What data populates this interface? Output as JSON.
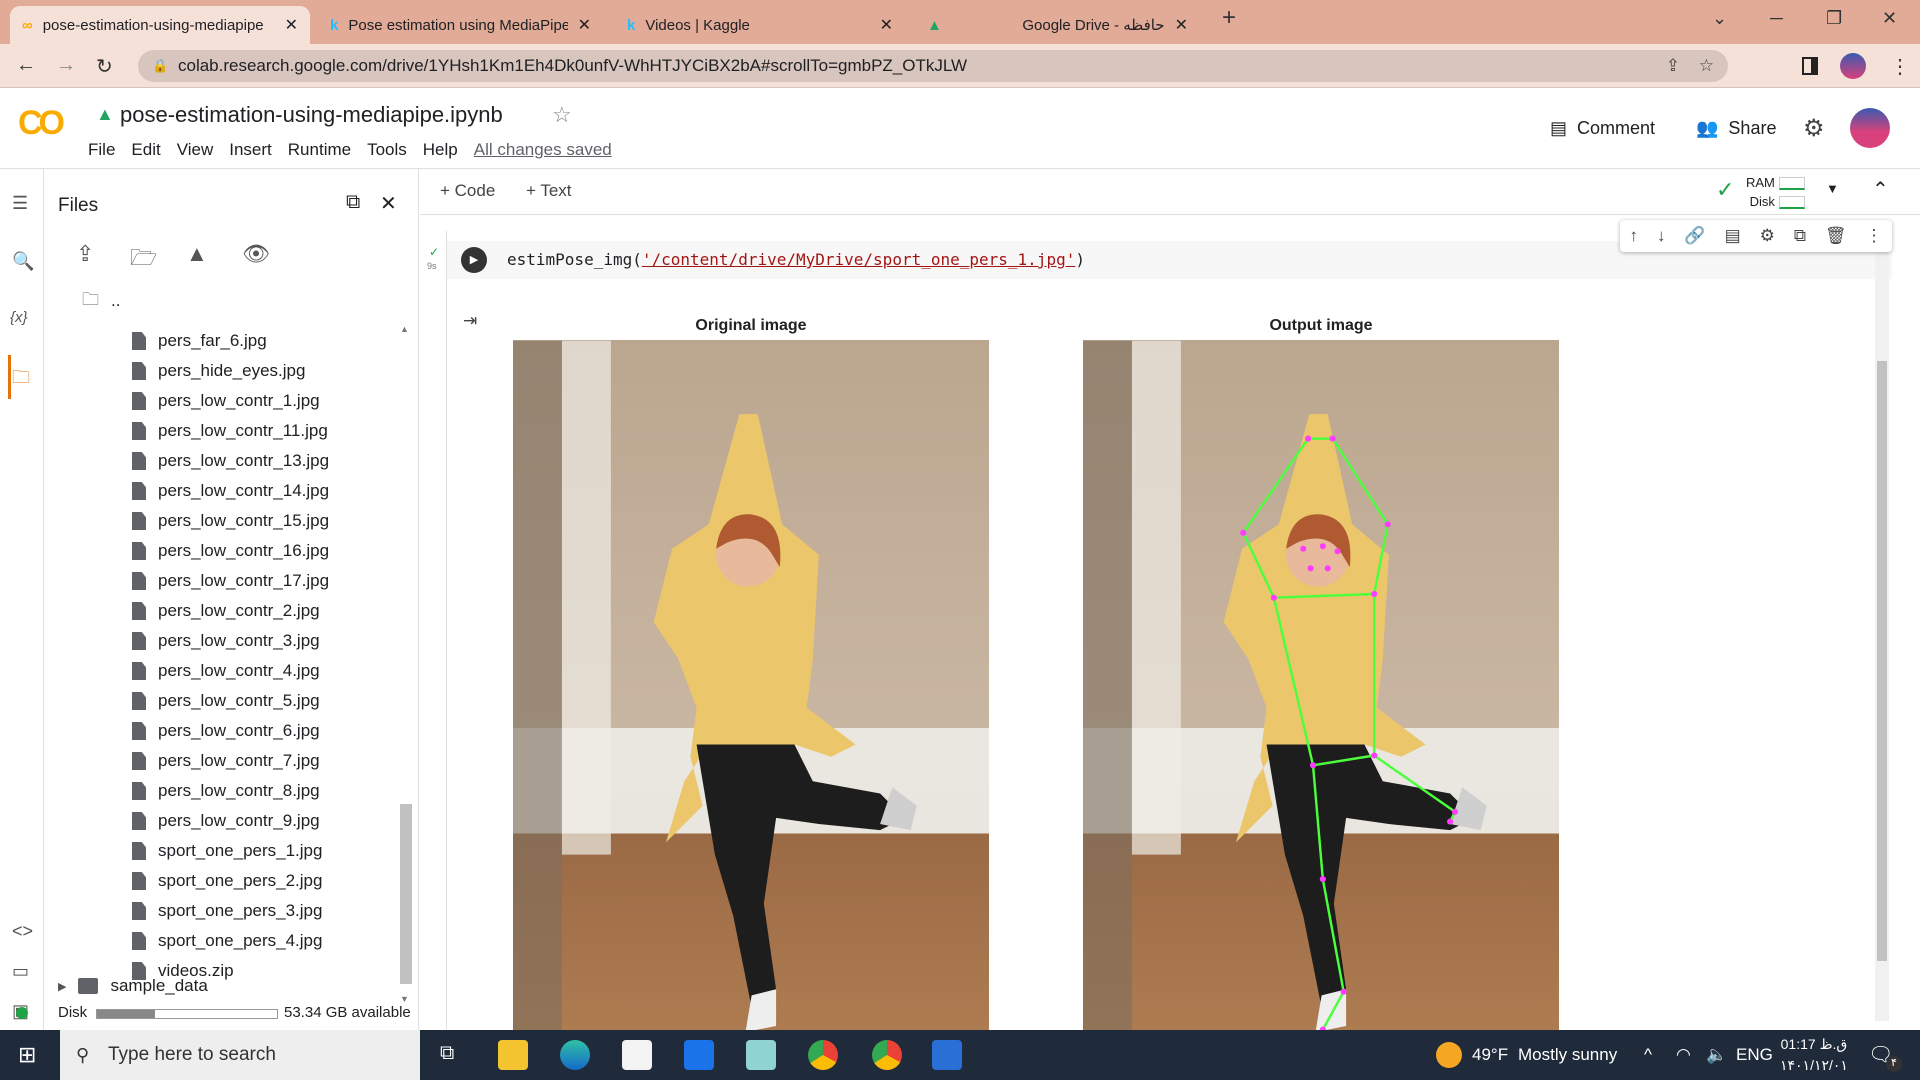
{
  "browser": {
    "tabs": [
      {
        "title": "pose-estimation-using-mediapipe",
        "active": true
      },
      {
        "title": "Pose estimation using MediaPipe",
        "active": false
      },
      {
        "title": "Videos | Kaggle",
        "active": false
      },
      {
        "title": "Google Drive - حافظه",
        "active": false
      }
    ],
    "url": "colab.research.google.com/drive/1YHsh1Km1Eh4Dk0unfV-WhHTJYCiBX2bA#scrollTo=gmbPZ_OTkJLW"
  },
  "colab": {
    "logo": "CO",
    "notebook_title": "pose-estimation-using-mediapipe.ipynb",
    "menu": [
      "File",
      "Edit",
      "View",
      "Insert",
      "Runtime",
      "Tools",
      "Help"
    ],
    "save_status": "All changes saved",
    "comment_label": "Comment",
    "share_label": "Share",
    "add_code": "+ Code",
    "add_text": "+ Text",
    "ram_label": "RAM",
    "disk_label": "Disk"
  },
  "files_panel": {
    "title": "Files",
    "parent": "..",
    "items": [
      "pers_far_6.jpg",
      "pers_hide_eyes.jpg",
      "pers_low_contr_1.jpg",
      "pers_low_contr_11.jpg",
      "pers_low_contr_13.jpg",
      "pers_low_contr_14.jpg",
      "pers_low_contr_15.jpg",
      "pers_low_contr_16.jpg",
      "pers_low_contr_17.jpg",
      "pers_low_contr_2.jpg",
      "pers_low_contr_3.jpg",
      "pers_low_contr_4.jpg",
      "pers_low_contr_5.jpg",
      "pers_low_contr_6.jpg",
      "pers_low_contr_7.jpg",
      "pers_low_contr_8.jpg",
      "pers_low_contr_9.jpg",
      "sport_one_pers_1.jpg",
      "sport_one_pers_2.jpg",
      "sport_one_pers_3.jpg",
      "sport_one_pers_4.jpg",
      "videos.zip"
    ],
    "folder": "sample_data",
    "disk_label": "Disk",
    "disk_available": "53.34 GB available",
    "disk_used_fraction": 0.32
  },
  "cell": {
    "exec_time": "9s",
    "code_prefix": "estimPose_img(",
    "code_string": "'/content/drive/MyDrive/sport_one_pers_1.jpg'",
    "code_suffix": ")",
    "output_titles": [
      "Original image",
      "Output image"
    ]
  },
  "taskbar": {
    "search_placeholder": "Type here to search",
    "weather_temp": "49°F",
    "weather_text": "Mostly sunny",
    "lang": "ENG",
    "time": "01:17 ق.ظ",
    "date": "۱۴۰۱/۱۲/۰۱",
    "notifications": "۴"
  },
  "colors": {
    "tabbar": "#e2ab98",
    "accent_orange": "#f9ab00",
    "skeleton": "#4cff3c",
    "joint": "#ff3cff"
  }
}
